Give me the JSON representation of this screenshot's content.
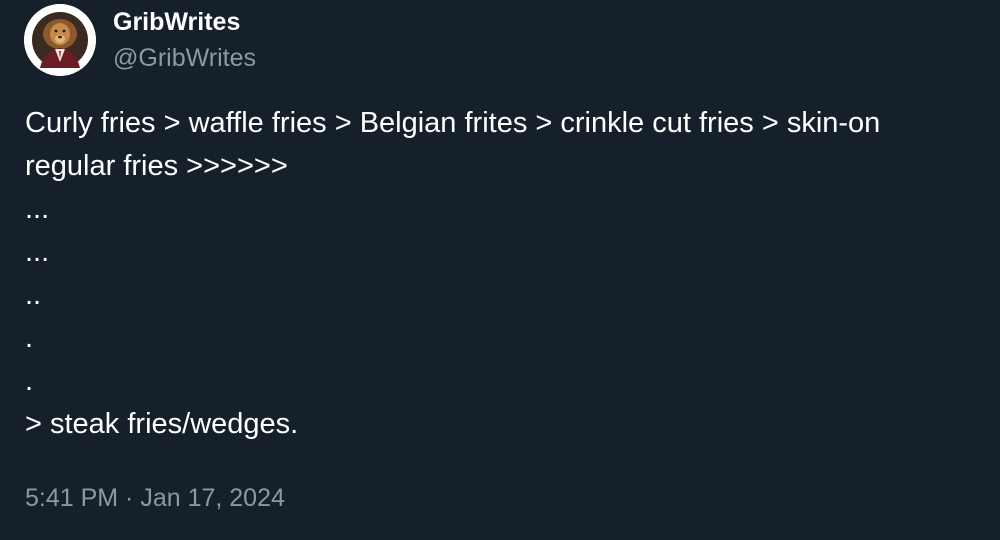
{
  "author": {
    "display_name": "GribWrites",
    "handle": "@GribWrites",
    "avatar_icon": "lion-in-suit-portrait-icon"
  },
  "tweet": {
    "lines": [
      "Curly fries > waffle fries > Belgian frites > crinkle cut fries > skin-on",
      "regular fries >>>>>>",
      "...",
      "...",
      "..",
      ".",
      ".",
      "> steak fries/wedges."
    ],
    "timestamp": "5:41 PM · Jan 17, 2024"
  },
  "colors": {
    "background": "#15202b",
    "primary_text": "#ffffff",
    "secondary_text": "#8b98a5"
  }
}
